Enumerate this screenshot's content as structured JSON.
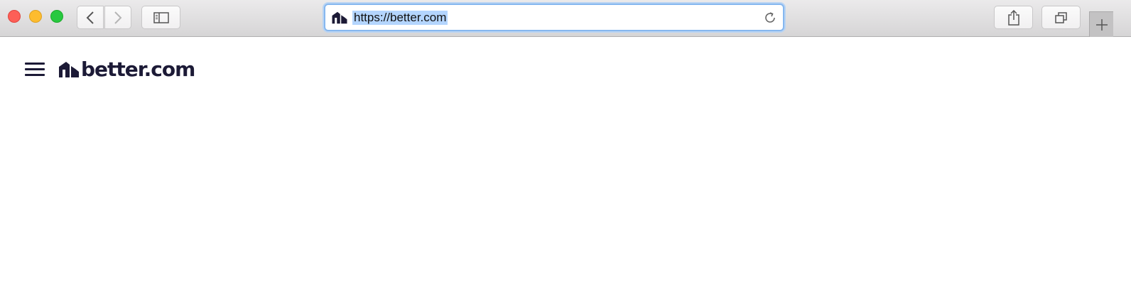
{
  "browser": {
    "address_bar": {
      "url": "https://better.com"
    },
    "icons": {
      "back": "chevron-left-icon",
      "forward": "chevron-right-icon",
      "sidebar": "sidebar-icon",
      "reload": "reload-icon",
      "share": "share-icon",
      "tabs": "tabs-icon",
      "new_tab": "plus-icon"
    },
    "colors": {
      "close": "#fd5f57",
      "minimize": "#fdbc2e",
      "zoom": "#28c840",
      "url_selection": "#b4d5fe",
      "focus_ring": "#86b7ef"
    }
  },
  "page": {
    "header": {
      "menu_icon": "hamburger-menu-icon",
      "logo_text": "better.com"
    },
    "colors": {
      "brand": "#1c1a36"
    }
  }
}
